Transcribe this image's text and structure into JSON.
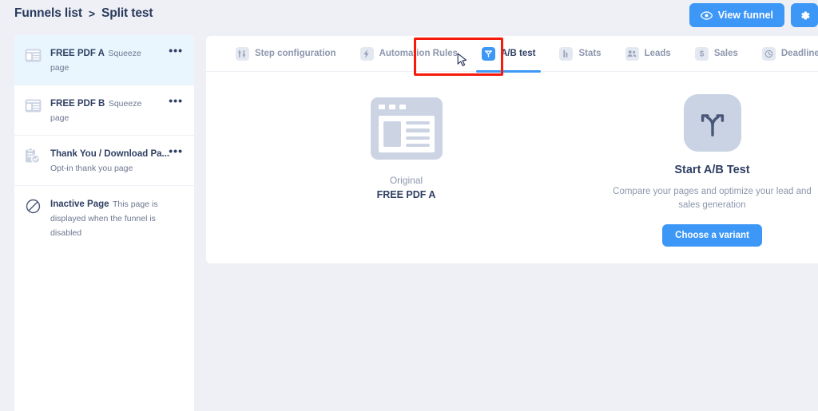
{
  "header": {
    "breadcrumb": {
      "root_label": "Funnels list",
      "separator": ">",
      "current_label": "Split test"
    },
    "view_funnel_label": "View funnel",
    "view_funnel_icon": "eye-icon",
    "settings_icon": "gear-icon",
    "accent_color": "#3d97f7"
  },
  "sidebar": {
    "pages": [
      {
        "title": "FREE PDF A",
        "subtitle": "Squeeze page",
        "icon": "squeeze-page-icon",
        "active": true,
        "menu": "•••"
      },
      {
        "title": "FREE PDF B",
        "subtitle": "Squeeze page",
        "icon": "squeeze-page-icon",
        "active": false,
        "menu": "•••"
      },
      {
        "title": "Thank You / Download Pa...",
        "subtitle": "Opt-in thank you page",
        "icon": "clipboard-check-icon",
        "active": false,
        "menu": "•••"
      },
      {
        "title": "Inactive Page",
        "subtitle": "This page is displayed when the funnel is disabled",
        "icon": "prohibited-icon",
        "active": false,
        "menu": ""
      }
    ]
  },
  "main": {
    "tabs": [
      {
        "label": "Step configuration",
        "icon": "sliders-icon",
        "active": false
      },
      {
        "label": "Automation Rules",
        "icon": "bolt-icon",
        "active": false
      },
      {
        "label": "A/B test",
        "icon": "split-test-icon",
        "active": true
      },
      {
        "label": "Stats",
        "icon": "bar-chart-icon",
        "active": false
      },
      {
        "label": "Leads",
        "icon": "people-icon",
        "active": false
      },
      {
        "label": "Sales",
        "icon": "dollar-icon",
        "active": false
      },
      {
        "label": "Deadline settings",
        "icon": "clock-icon",
        "active": false
      }
    ],
    "original": {
      "icon": "page-thumbnail-icon",
      "caption": "Original",
      "page_name": "FREE PDF A"
    },
    "abtest": {
      "icon": "split-arrows-icon",
      "title": "Start A/B Test",
      "description": "Compare your pages and optimize your lead and sales generation",
      "button_label": "Choose a variant"
    }
  },
  "annotation": {
    "highlight_color": "#f61a0d",
    "highlight_target": "A/B test",
    "cursor_icon": "mouse-pointer-icon"
  }
}
